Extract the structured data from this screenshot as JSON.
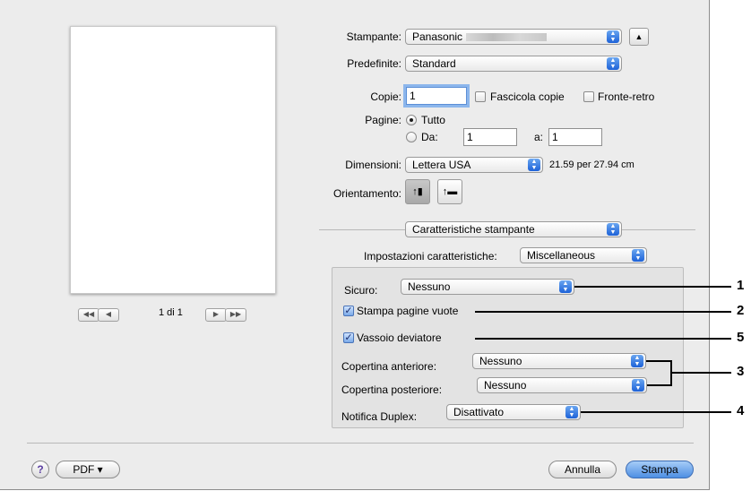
{
  "printer": {
    "label": "Stampante:",
    "value": "Panasonic"
  },
  "presets": {
    "label": "Predefinite:",
    "value": "Standard"
  },
  "copies": {
    "label": "Copie:",
    "value": "1",
    "collate_label": "Fascicola copie",
    "duplex_label": "Fronte-retro",
    "collate_checked": false,
    "duplex_checked": false
  },
  "pages": {
    "label": "Pagine:",
    "all_label": "Tutto",
    "from_label": "Da:",
    "from_value": "1",
    "to_label": "a:",
    "to_value": "1",
    "selected": "all"
  },
  "paper_size": {
    "label": "Dimensioni:",
    "value": "Lettera USA",
    "dims": "21.59 per 27.94 cm"
  },
  "orientation": {
    "label": "Orientamento:",
    "selected": "portrait"
  },
  "panel": {
    "value": "Caratteristiche stampante"
  },
  "feature_sets": {
    "label": "Impostazioni caratteristiche:",
    "value": "Miscellaneous"
  },
  "options": {
    "secure": {
      "label": "Sicuro:",
      "value": "Nessuno"
    },
    "print_blank": {
      "label": "Stampa pagine vuote",
      "checked": true
    },
    "bypass_tray": {
      "label": "Vassoio deviatore",
      "checked": true
    },
    "front_cover": {
      "label": "Copertina anteriore:",
      "value": "Nessuno"
    },
    "back_cover": {
      "label": "Copertina posteriore:",
      "value": "Nessuno"
    },
    "duplex_notify": {
      "label": "Notifica Duplex:",
      "value": "Disattivato"
    }
  },
  "preview_nav": {
    "page_text": "1 di 1"
  },
  "footer": {
    "help": "?",
    "pdf": "PDF ▾",
    "cancel": "Annulla",
    "print": "Stampa"
  },
  "callouts": {
    "n1": "1",
    "n2": "2",
    "n5": "5",
    "n3": "3",
    "n4": "4"
  },
  "colors": {
    "accent": "#4e8fe3",
    "dialog_bg": "#ececec"
  }
}
